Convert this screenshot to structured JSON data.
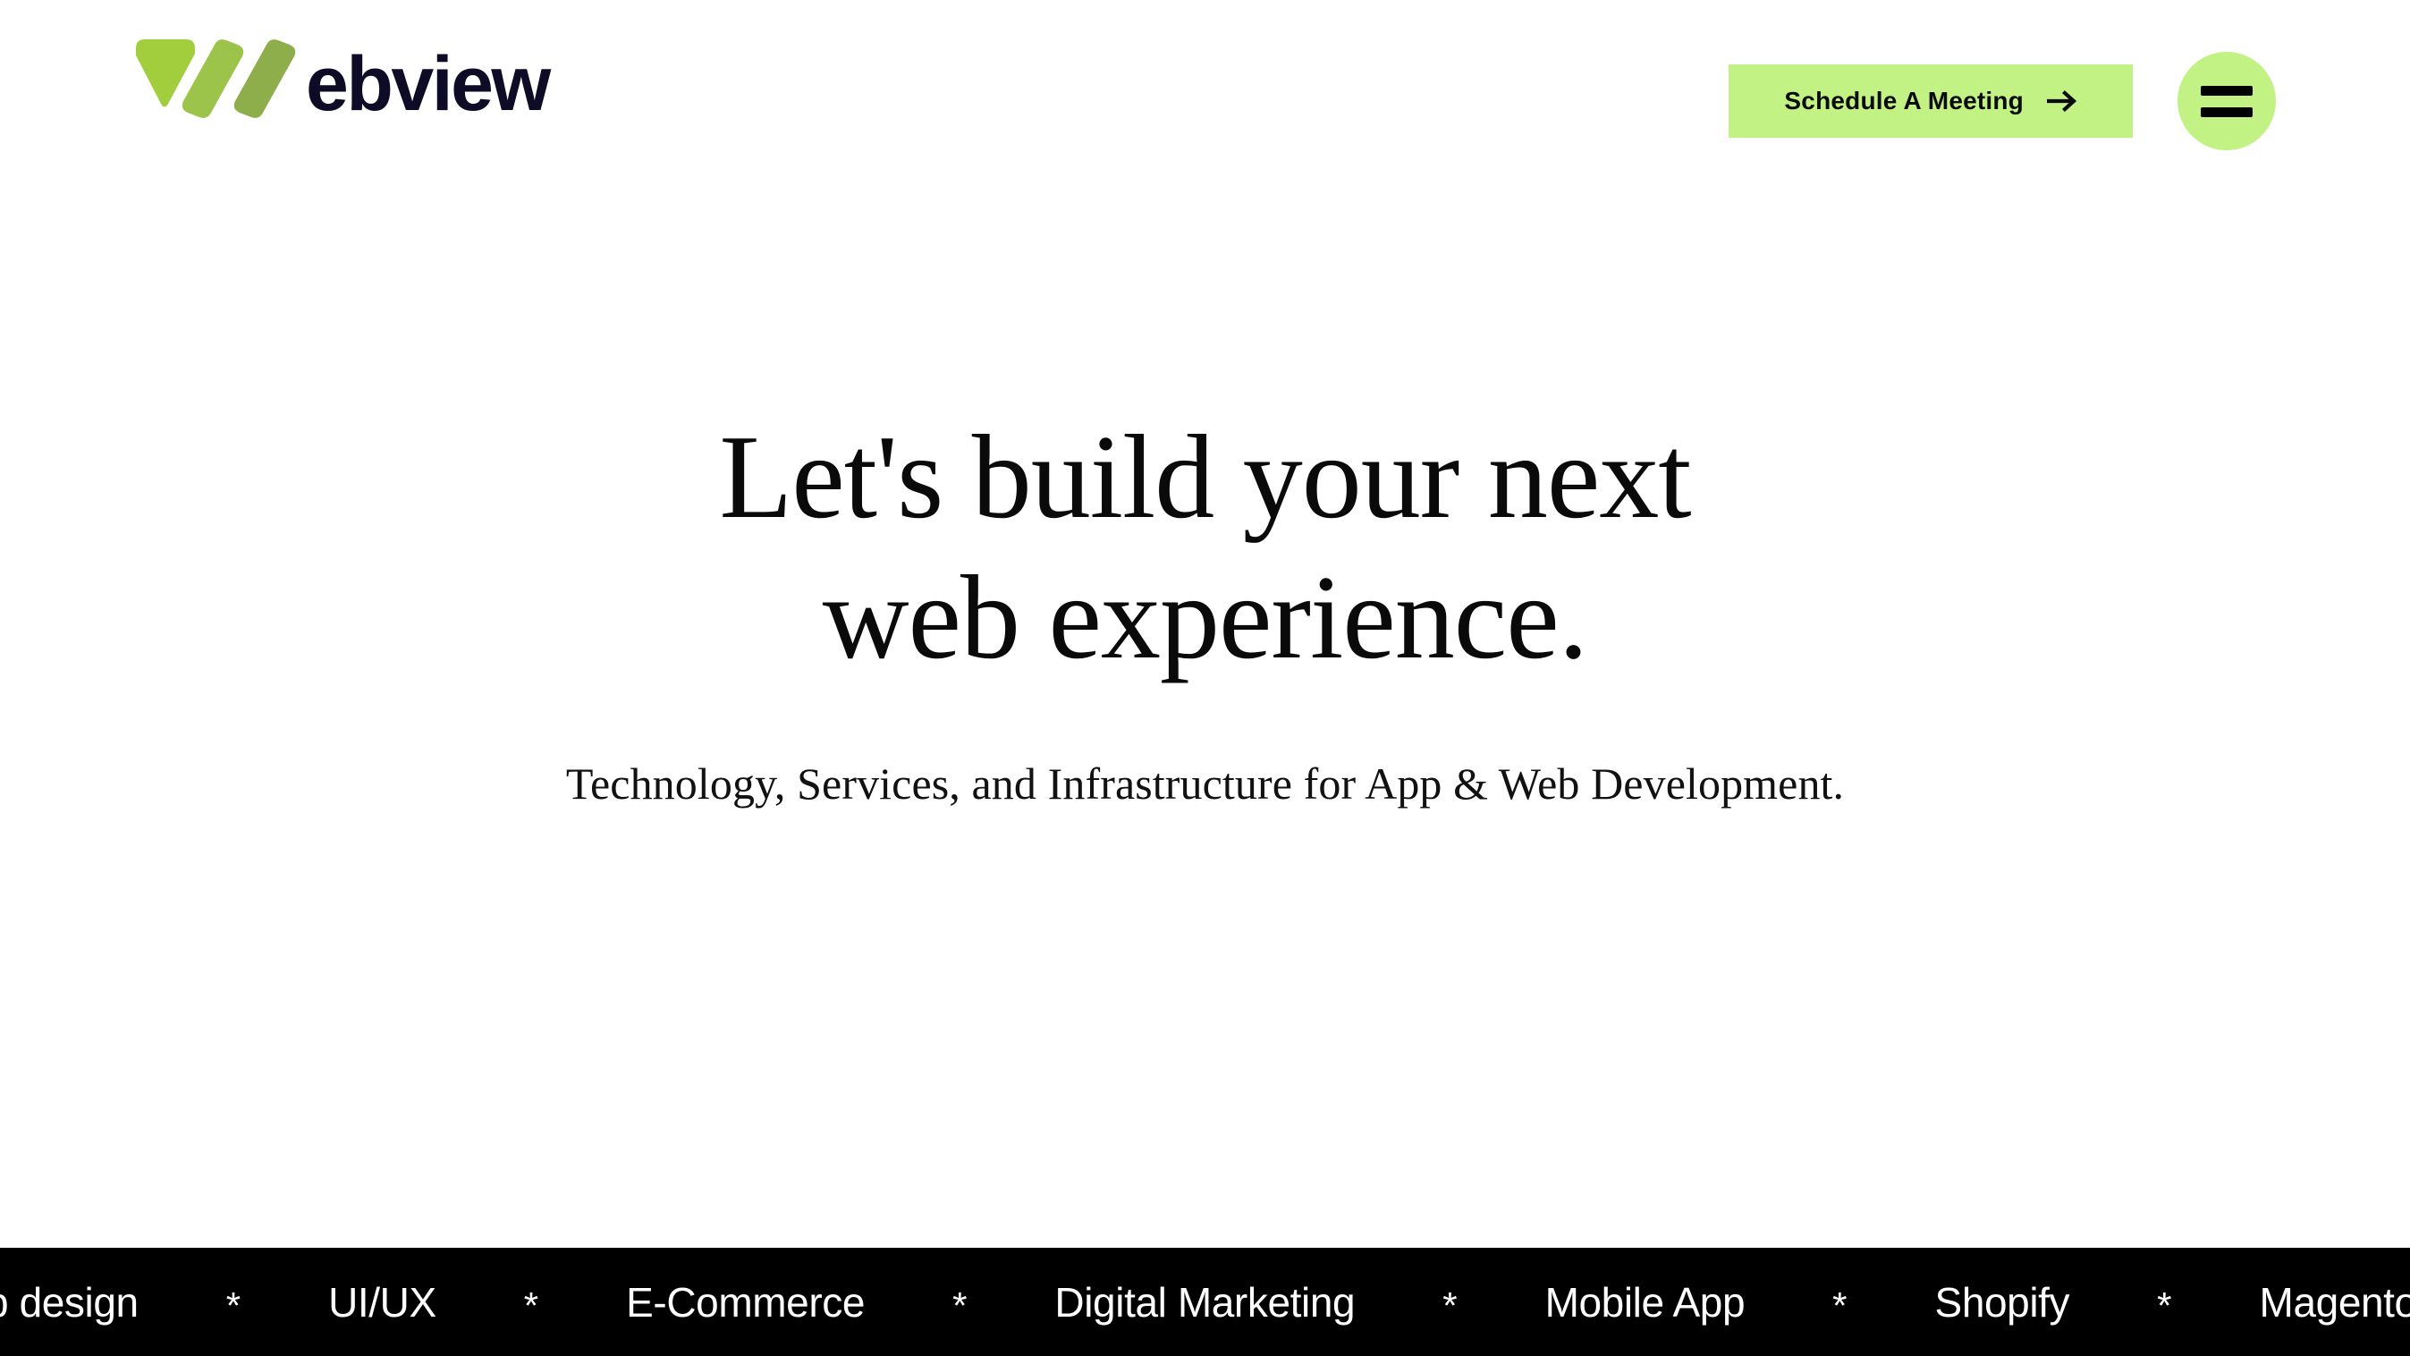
{
  "brand": {
    "logo_icon": "webview-w-logo-icon",
    "wordmark": "ebview",
    "colors": {
      "chevron": "#a2ce3d",
      "bar_mid": "#9cc34a",
      "bar_dark": "#8dae4a",
      "wordmark": "#0d0b26"
    }
  },
  "header": {
    "cta_label": "Schedule A Meeting",
    "cta_arrow_icon": "arrow-right-icon",
    "cta_bg": "#c1f283",
    "menu_icon": "hamburger-menu-icon",
    "menu_bg": "#c1f283"
  },
  "hero": {
    "title_line1": "Let's build your next",
    "title_line2": "web experience.",
    "subtitle": "Technology, Services, and Infrastructure for App & Web Development."
  },
  "marquee": {
    "background": "#000000",
    "text_color": "#ffffff",
    "separator": "*",
    "items": [
      "b design",
      "UI/UX",
      "E-Commerce",
      "Digital Marketing",
      "Mobile App",
      "Shopify",
      "Magento"
    ]
  }
}
